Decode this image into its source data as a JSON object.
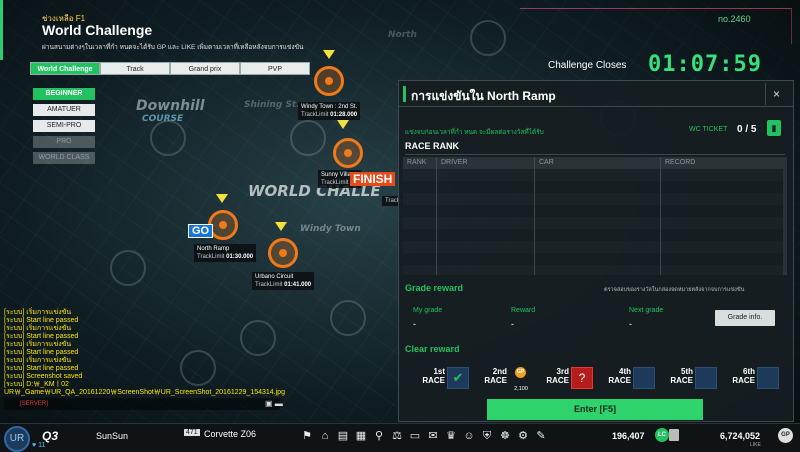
{
  "header": {
    "subtitle": "ช่วงเหลือ F1",
    "title": "World Challenge",
    "description": "ผ่านสนามต่างๆในเวลาที่กำ หนดจะได้รับ GP และ LIKE เพิ่มตามเวลาที่เหลือหลังจบการแข่งขัน",
    "corner_number": "no.2460"
  },
  "mode_tabs": [
    "World Challenge",
    "Track",
    "Grand prix",
    "PVP"
  ],
  "difficulties": [
    {
      "label": "BEGINNER",
      "state": "active"
    },
    {
      "label": "AMATUER",
      "state": "normal"
    },
    {
      "label": "SEMI-PRO",
      "state": "normal"
    },
    {
      "label": "PRO",
      "state": "locked"
    },
    {
      "label": "WORLD CLASS",
      "state": "locked"
    }
  ],
  "map": {
    "course_title": "Downhill",
    "course_sub": "COURSE",
    "big_label": "WORLD CHALLE",
    "area_labels": [
      "Shining St.",
      "Windy Town",
      "North"
    ],
    "go": "GO",
    "finish": "FINISH",
    "tracks": [
      {
        "name": "Windy Town : 2nd St.",
        "limit_label": "TrackLimit",
        "limit": "01:28.000"
      },
      {
        "name": "Sunny Village",
        "limit_label": "TrackLimit",
        "limit": ""
      },
      {
        "name": "North Ramp",
        "limit_label": "TrackLimit",
        "limit": "01:30.000"
      },
      {
        "name": "Urbano Circuit",
        "limit_label": "TrackLimit",
        "limit": "01:41.000"
      },
      {
        "name": "",
        "limit_label": "TrackLi",
        "limit": ""
      }
    ]
  },
  "challenge": {
    "closes_label": "Challenge Closes",
    "timer": "01:07:59"
  },
  "chat": {
    "lines": [
      "[ระบบ] เริ่มการแข่งขัน",
      "[ระบบ] Start line passed",
      "[ระบบ] เริ่มการแข่งขัน",
      "[ระบบ] Start line passed",
      "[ระบบ] เริ่มการแข่งขัน",
      "[ระบบ] Start line passed",
      "[ระบบ] เริ่มการแข่งขัน",
      "[ระบบ] Start line passed",
      "[ระบบ] Screenshot saved",
      "[ระบบ] D:￦_KMￜ02 UR￦_Game￦UR_QA_20161220￦ScreenShot￦UR_ScreenShot_20161229_154314.jpg"
    ],
    "input_prefix": "[SERVER]"
  },
  "panel": {
    "title": "การแข่งขันใน North Ramp",
    "close": "×",
    "desc": "แข่งจบก่อนเวลาที่กำ หนด จะมีผลต่อรางวัลที่ได้รับ",
    "wc_ticket_label": "WC TICKET",
    "wc_ticket_value": "0 / 5",
    "race_rank_title": "RACE RANK",
    "rank_columns": [
      "RANK",
      "DRIVER",
      "CAR",
      "RECORD"
    ],
    "grade_title": "Grade reward",
    "grade_note": "ตรวจสอบของรางวัลในกล่องจดหมายหลังจากจบการแข่งขัน",
    "grade_cols": [
      {
        "label": "My grade",
        "value": "-"
      },
      {
        "label": "Reward",
        "value": "-"
      },
      {
        "label": "Next grade",
        "value": "-"
      }
    ],
    "grade_info_btn": "Grade info.",
    "clear_title": "Clear reward",
    "races": [
      {
        "n": "1st",
        "w": "RACE",
        "icon": "✔"
      },
      {
        "n": "2nd",
        "w": "RACE",
        "icon": "GP",
        "amount": "2,100"
      },
      {
        "n": "3rd",
        "w": "RACE",
        "icon": "?"
      },
      {
        "n": "4th",
        "w": "RACE",
        "icon": ""
      },
      {
        "n": "5th",
        "w": "RACE",
        "icon": ""
      },
      {
        "n": "6th",
        "w": "RACE",
        "icon": ""
      }
    ],
    "enter_btn": "Enter [F5]"
  },
  "bottom": {
    "avatar": "UR",
    "rank_badge": "Q3",
    "hearts": "♥ 11",
    "player_name": "SunSun",
    "car_level": "471",
    "car_name": "Corvette Z06",
    "lc_value": "196,407",
    "lc_icon": "LC",
    "gp_value": "6,724,052",
    "gp_icon": "GP",
    "like_label": "LIKE"
  },
  "colors": {
    "accent": "#21c25f",
    "marker": "#f07a1a",
    "timer": "#39e07a"
  }
}
